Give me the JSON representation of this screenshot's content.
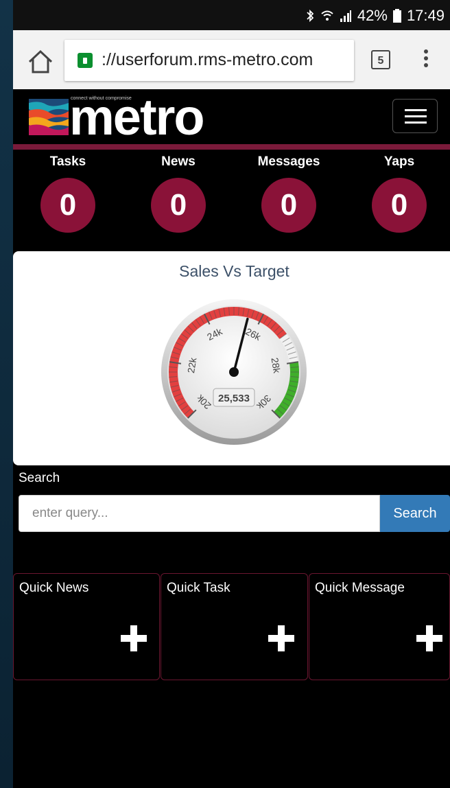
{
  "status_bar": {
    "battery": "42%",
    "time": "17:49",
    "icons": [
      "bluetooth-icon",
      "wifi-icon",
      "signal-icon",
      "battery-icon"
    ]
  },
  "browser": {
    "url": "://userforum.rms-metro.com",
    "tab_count": "5",
    "icons": [
      "home-icon",
      "lock-icon",
      "menu-dots-icon"
    ]
  },
  "header": {
    "logo_text": "metro",
    "tagline": "connect without compromise"
  },
  "counters": [
    {
      "label": "Tasks",
      "value": "0"
    },
    {
      "label": "News",
      "value": "0"
    },
    {
      "label": "Messages",
      "value": "0"
    },
    {
      "label": "Yaps",
      "value": "0"
    }
  ],
  "gauge": {
    "title": "Sales Vs Target",
    "value_display": "25,533",
    "value": 25533,
    "min": 20000,
    "max": 30000,
    "ticks": [
      "20k",
      "22k",
      "24k",
      "26k",
      "28k",
      "30k"
    ],
    "bands": [
      {
        "from": 20000,
        "to": 27000,
        "color": "#e2403f"
      },
      {
        "from": 27000,
        "to": 28000,
        "color": "#f2f2f2"
      },
      {
        "from": 28000,
        "to": 30000,
        "color": "#3fae2a"
      }
    ]
  },
  "search": {
    "label": "Search",
    "placeholder": "enter query...",
    "button": "Search"
  },
  "quick_actions": [
    {
      "label": "Quick News"
    },
    {
      "label": "Quick Task"
    },
    {
      "label": "Quick Message"
    }
  ],
  "colors": {
    "accent": "#8a1238",
    "button": "#337ab7",
    "divider": "#7a1a3a"
  }
}
